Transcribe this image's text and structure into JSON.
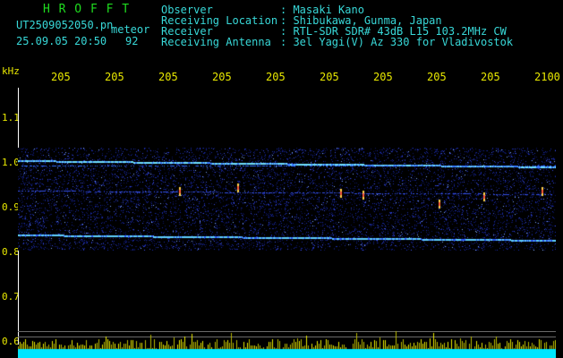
{
  "header": {
    "brand": "H R O F F T",
    "filename": "UT2509052050.pn",
    "meteor_label": "meteor",
    "datetime": "25.09.05 20:50",
    "count": "92",
    "info": [
      {
        "label": "Observer",
        "value": ": Masaki Kano"
      },
      {
        "label": "Receiving Location",
        "value": ": Shibukawa, Gunma, Japan"
      },
      {
        "label": "Receiver",
        "value": ": RTL-SDR SDR# 43dB L15 103.2MHz CW"
      },
      {
        "label": "Receiving Antenna",
        "value": ": 3el Yagi(V) Az 330 for Vladivostok"
      }
    ]
  },
  "time_axis": {
    "ticks": [
      "205",
      "205",
      "205",
      "205",
      "205",
      "205",
      "205",
      "205",
      "205",
      "2100"
    ]
  },
  "freq_axis": {
    "unit": "kHz",
    "ticks": [
      "1.1",
      "1.0",
      "0.9",
      "0.8",
      "0.7",
      "0.6"
    ]
  },
  "colors": {
    "label_green": "#1fdc1f",
    "label_cyan": "#38d8d8",
    "tick_yellow": "#e8e800",
    "noise_blue": "#1a2aa8",
    "carrier_cyan": "#6fe0ff",
    "meteor_yellow": "#ffd24a",
    "meteor_red": "#ff5a3a",
    "baseline_cyan": "#00e5ff"
  }
}
